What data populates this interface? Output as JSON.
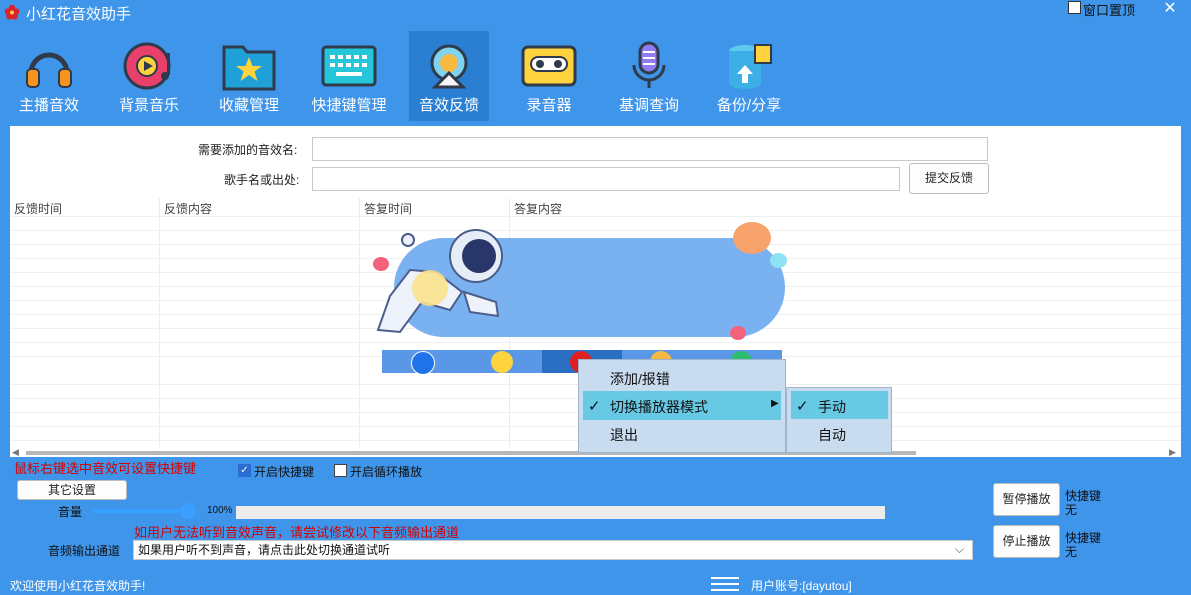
{
  "app": {
    "title": "小红花音效助手",
    "pin_label": "窗口置顶",
    "close_label": "✕"
  },
  "toolbar": [
    {
      "label": "主播音效",
      "icon": "headphones-icon"
    },
    {
      "label": "背景音乐",
      "icon": "music-disc-icon"
    },
    {
      "label": "收藏管理",
      "icon": "star-folder-icon"
    },
    {
      "label": "快捷键管理",
      "icon": "keyboard-icon"
    },
    {
      "label": "音效反馈",
      "icon": "feedback-icon",
      "active": true
    },
    {
      "label": "录音器",
      "icon": "cassette-icon"
    },
    {
      "label": "基调查询",
      "icon": "microphone-icon"
    },
    {
      "label": "备份/分享",
      "icon": "backup-icon"
    }
  ],
  "form": {
    "name_label": "需要添加的音效名:",
    "name_value": "",
    "source_label": "歌手名或出处:",
    "source_value": "",
    "submit_label": "提交反馈"
  },
  "table": {
    "columns": [
      "反馈时间",
      "反馈内容",
      "答复时间",
      "答复内容"
    ],
    "rows": []
  },
  "context_menu": {
    "items": [
      "添加/报错",
      "切换播放器模式",
      "退出"
    ],
    "submenu": [
      "手动",
      "自动"
    ]
  },
  "controls": {
    "tip": "鼠标右键选中音效可设置快捷键",
    "enable_hotkey_label": "开启快捷键",
    "enable_hotkey": true,
    "loop_label": "开启循环播放",
    "loop": false,
    "other_settings_label": "其它设置",
    "volume_label": "音量",
    "volume_percent": 100,
    "volume_text": "100%",
    "output_tip": "如用户无法听到音效声音，请尝试修改以下音频输出通道",
    "output_label": "音频输出通道",
    "output_value": "如果用户听不到声音，请点击此处切换通道试听",
    "pause_label": "暂停播放",
    "stop_label": "停止播放",
    "hotkey_label": "快捷键",
    "hotkey_none": "无"
  },
  "status": {
    "left": "欢迎使用小红花音效助手!",
    "right": "用户账号:[dayutou]"
  },
  "colors": {
    "accent": "#3f95ea",
    "active_tab": "#2b7fd3",
    "warning": "#d40000",
    "menu_highlight": "#67c9e4"
  }
}
